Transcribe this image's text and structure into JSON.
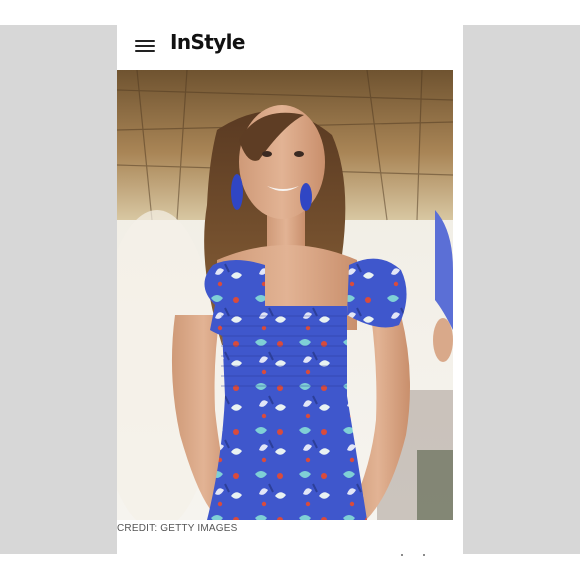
{
  "header": {
    "logo_text": "InStyle",
    "menu_icon": "hamburger-menu-icon"
  },
  "article": {
    "photo_credit": "CREDIT: GETTY IMAGES"
  },
  "colors": {
    "dress_blue": "#3d55c8",
    "side_panel": "#d7d7d7",
    "background": "#ffffff"
  }
}
